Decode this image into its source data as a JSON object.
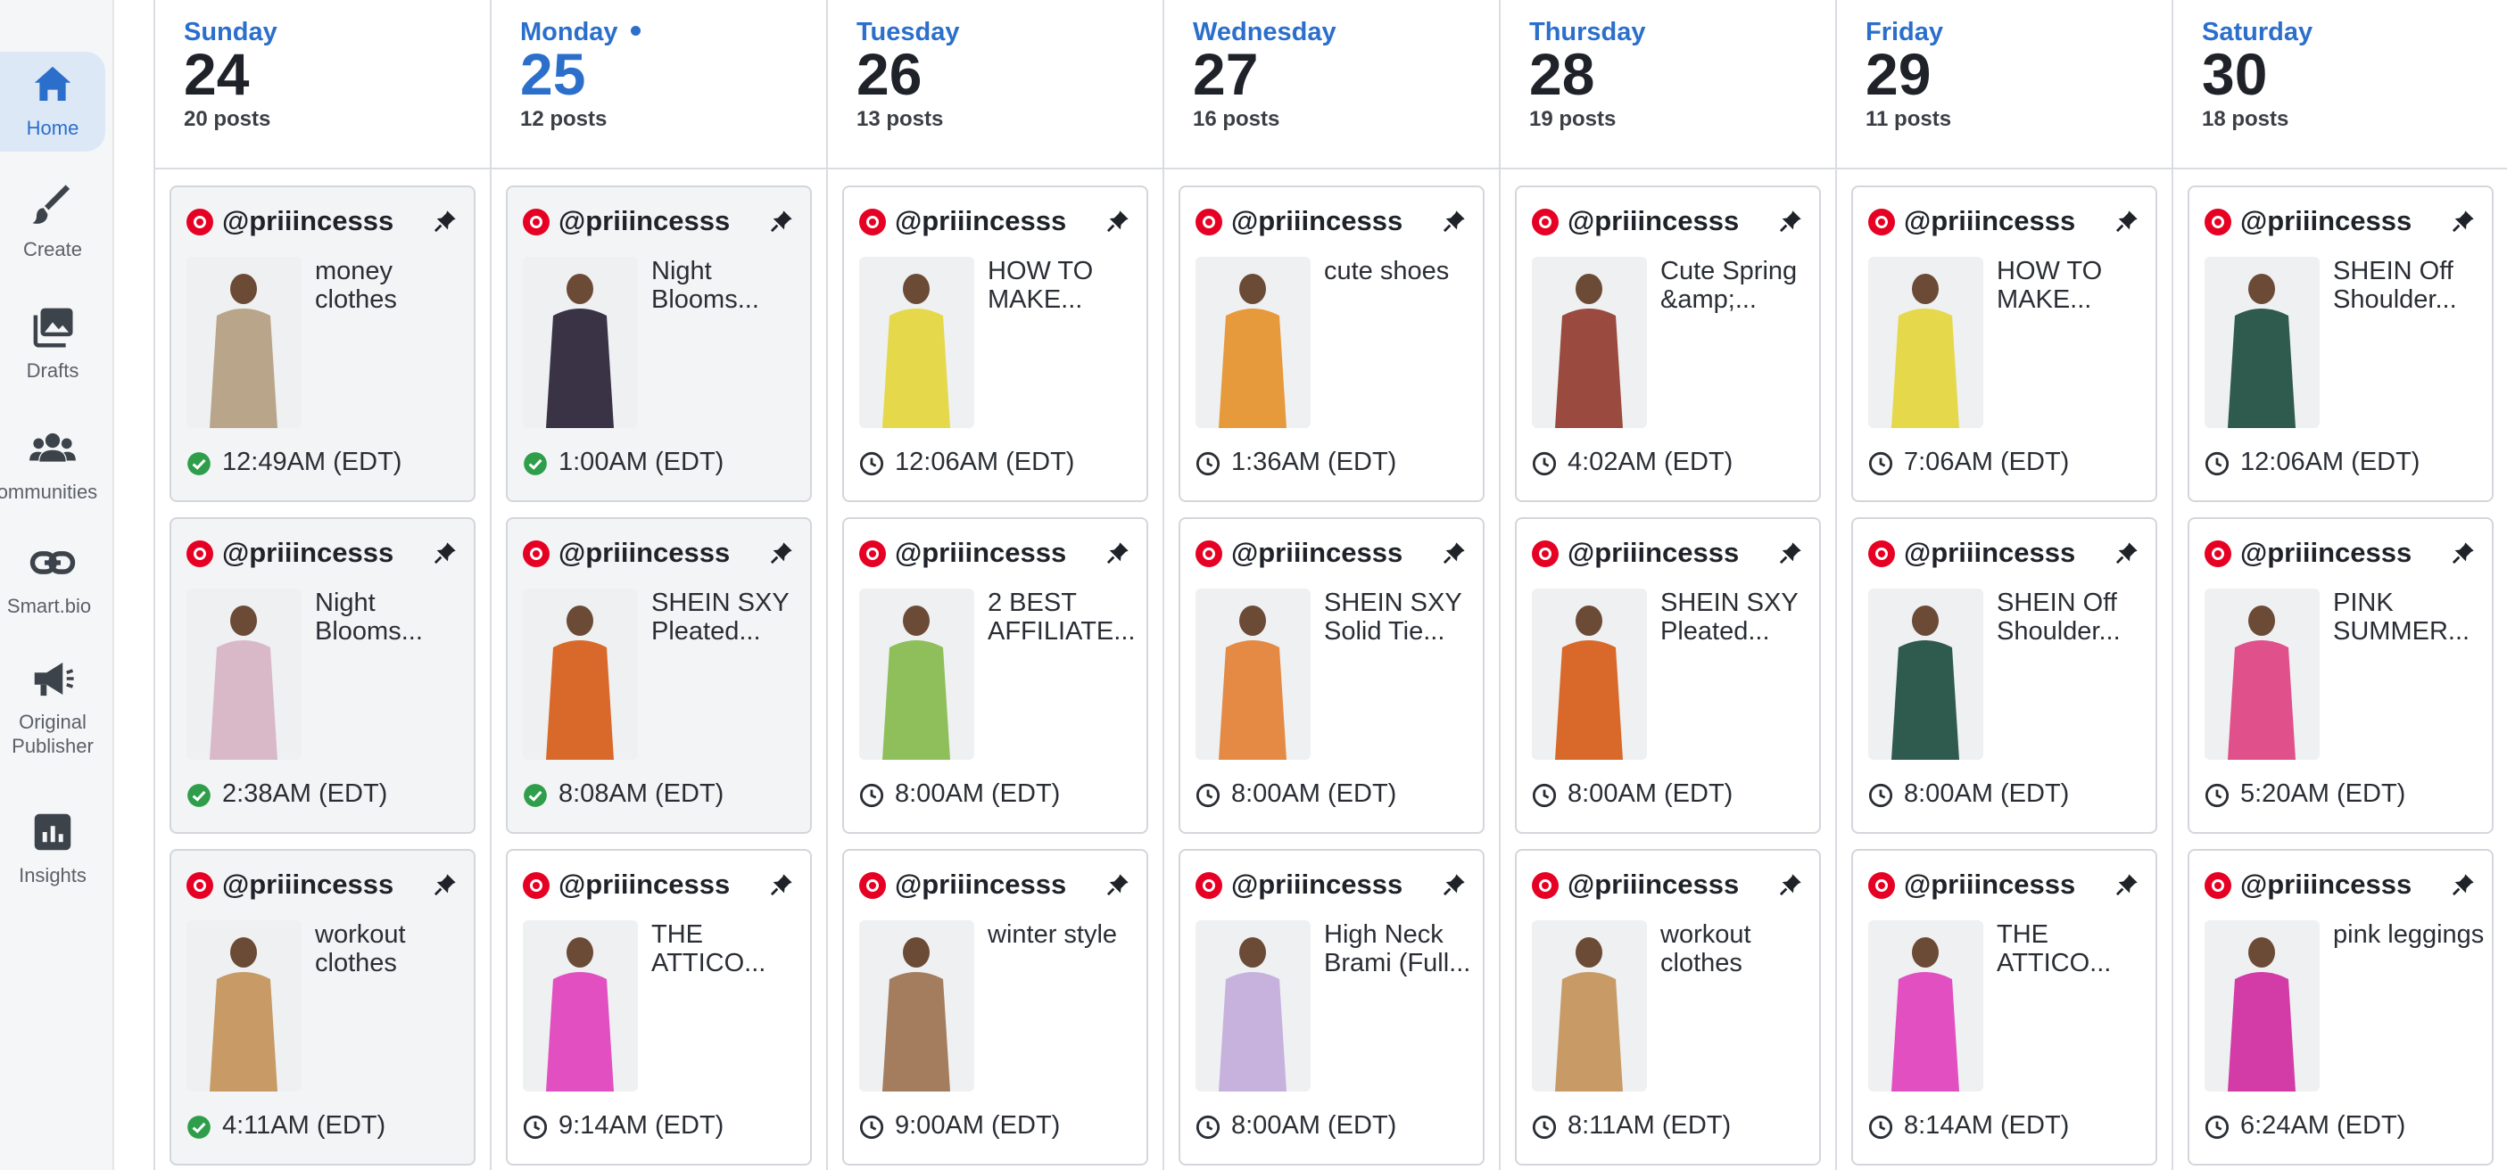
{
  "sidebar": {
    "items": [
      {
        "label": "Home",
        "icon": "home-icon",
        "active": true
      },
      {
        "label": "Create",
        "icon": "brush-icon",
        "active": false
      },
      {
        "label": "Drafts",
        "icon": "images-icon",
        "active": false
      },
      {
        "label": "Communities",
        "icon": "people-icon",
        "active": false
      },
      {
        "label": "Smart.bio",
        "icon": "link-icon",
        "active": false
      },
      {
        "label": "Original Publisher",
        "icon": "megaphone-icon",
        "active": false
      },
      {
        "label": "Insights",
        "icon": "chart-icon",
        "active": false
      }
    ]
  },
  "colors": {
    "accent": "#2b6fcb",
    "pinterest": "#e60023",
    "published": "#2e9e4a"
  },
  "calendar": {
    "days": [
      {
        "name": "Sunday",
        "date": "24",
        "count": "20 posts",
        "today": false,
        "posts": [
          {
            "handle": "@priiincesss",
            "title": "money clothes",
            "time": "12:49AM (EDT)",
            "status": "published",
            "thumb": "#b9a58a"
          },
          {
            "handle": "@priiincesss",
            "title": "Night Blooms...",
            "time": "2:38AM (EDT)",
            "status": "published",
            "thumb": "#d9b9c8"
          },
          {
            "handle": "@priiincesss",
            "title": "workout clothes",
            "time": "4:11AM (EDT)",
            "status": "published",
            "thumb": "#c79a66"
          }
        ]
      },
      {
        "name": "Monday",
        "date": "25",
        "count": "12 posts",
        "today": true,
        "posts": [
          {
            "handle": "@priiincesss",
            "title": "Night Blooms...",
            "time": "1:00AM (EDT)",
            "status": "published",
            "thumb": "#3a3346"
          },
          {
            "handle": "@priiincesss",
            "title": "SHEIN SXY Pleated...",
            "time": "8:08AM (EDT)",
            "status": "published",
            "thumb": "#d9692a"
          },
          {
            "handle": "@priiincesss",
            "title": "THE ATTICO...",
            "time": "9:14AM (EDT)",
            "status": "scheduled",
            "thumb": "#e24fc0"
          }
        ]
      },
      {
        "name": "Tuesday",
        "date": "26",
        "count": "13 posts",
        "today": false,
        "posts": [
          {
            "handle": "@priiincesss",
            "title": "HOW TO MAKE...",
            "time": "12:06AM (EDT)",
            "status": "scheduled",
            "thumb": "#e5d84a"
          },
          {
            "handle": "@priiincesss",
            "title": "2 BEST AFFILIATE...",
            "time": "8:00AM (EDT)",
            "status": "scheduled",
            "thumb": "#8fbf5a"
          },
          {
            "handle": "@priiincesss",
            "title": "winter style",
            "time": "9:00AM (EDT)",
            "status": "scheduled",
            "thumb": "#a47c5e"
          }
        ]
      },
      {
        "name": "Wednesday",
        "date": "27",
        "count": "16 posts",
        "today": false,
        "posts": [
          {
            "handle": "@priiincesss",
            "title": "cute shoes",
            "time": "1:36AM (EDT)",
            "status": "scheduled",
            "thumb": "#e79a3c"
          },
          {
            "handle": "@priiincesss",
            "title": "SHEIN SXY Solid Tie...",
            "time": "8:00AM (EDT)",
            "status": "scheduled",
            "thumb": "#e48a45"
          },
          {
            "handle": "@priiincesss",
            "title": "High Neck Brami (Full...",
            "time": "8:00AM (EDT)",
            "status": "scheduled",
            "thumb": "#c7b2de"
          }
        ]
      },
      {
        "name": "Thursday",
        "date": "28",
        "count": "19 posts",
        "today": false,
        "posts": [
          {
            "handle": "@priiincesss",
            "title": "Cute Spring &amp;...",
            "time": "4:02AM (EDT)",
            "status": "scheduled",
            "thumb": "#9a4a3e"
          },
          {
            "handle": "@priiincesss",
            "title": "SHEIN SXY Pleated...",
            "time": "8:00AM (EDT)",
            "status": "scheduled",
            "thumb": "#d9692a"
          },
          {
            "handle": "@priiincesss",
            "title": "workout clothes",
            "time": "8:11AM (EDT)",
            "status": "scheduled",
            "thumb": "#c79a66"
          }
        ]
      },
      {
        "name": "Friday",
        "date": "29",
        "count": "11 posts",
        "today": false,
        "posts": [
          {
            "handle": "@priiincesss",
            "title": "HOW TO MAKE...",
            "time": "7:06AM (EDT)",
            "status": "scheduled",
            "thumb": "#e5d84a"
          },
          {
            "handle": "@priiincesss",
            "title": "SHEIN Off Shoulder...",
            "time": "8:00AM (EDT)",
            "status": "scheduled",
            "thumb": "#2f5a4e"
          },
          {
            "handle": "@priiincesss",
            "title": "THE ATTICO...",
            "time": "8:14AM (EDT)",
            "status": "scheduled",
            "thumb": "#e24fc0"
          }
        ]
      },
      {
        "name": "Saturday",
        "date": "30",
        "count": "18 posts",
        "today": false,
        "posts": [
          {
            "handle": "@priiincesss",
            "title": "SHEIN Off Shoulder...",
            "time": "12:06AM (EDT)",
            "status": "scheduled",
            "thumb": "#2f5a4e"
          },
          {
            "handle": "@priiincesss",
            "title": "PINK SUMMER...",
            "time": "5:20AM (EDT)",
            "status": "scheduled",
            "thumb": "#e0508a"
          },
          {
            "handle": "@priiincesss",
            "title": "pink leggings",
            "time": "6:24AM (EDT)",
            "status": "scheduled",
            "thumb": "#d33ba6"
          }
        ]
      }
    ]
  }
}
